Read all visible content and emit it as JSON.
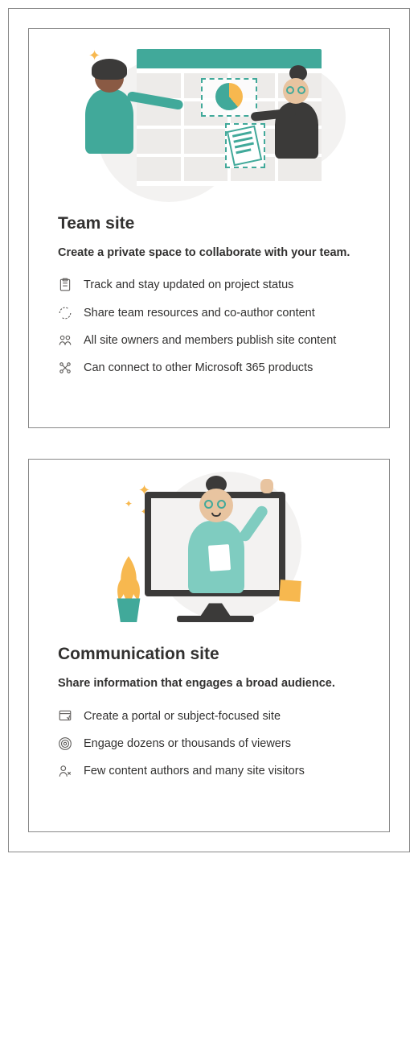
{
  "cards": [
    {
      "title": "Team site",
      "subtitle": "Create a private space to collaborate with your team.",
      "features": [
        {
          "icon": "clipboard-icon",
          "text": "Track and stay updated on project status"
        },
        {
          "icon": "refresh-icon",
          "text": "Share team resources and co-author content"
        },
        {
          "icon": "people-icon",
          "text": "All site owners and members publish site content"
        },
        {
          "icon": "connect-icon",
          "text": "Can connect to other Microsoft 365 products"
        }
      ]
    },
    {
      "title": "Communication site",
      "subtitle": "Share information that engages a broad audience.",
      "features": [
        {
          "icon": "portal-icon",
          "text": "Create a portal or subject-focused site"
        },
        {
          "icon": "broadcast-icon",
          "text": "Engage dozens or thousands of viewers"
        },
        {
          "icon": "author-icon",
          "text": "Few content authors and many site visitors"
        }
      ]
    }
  ]
}
